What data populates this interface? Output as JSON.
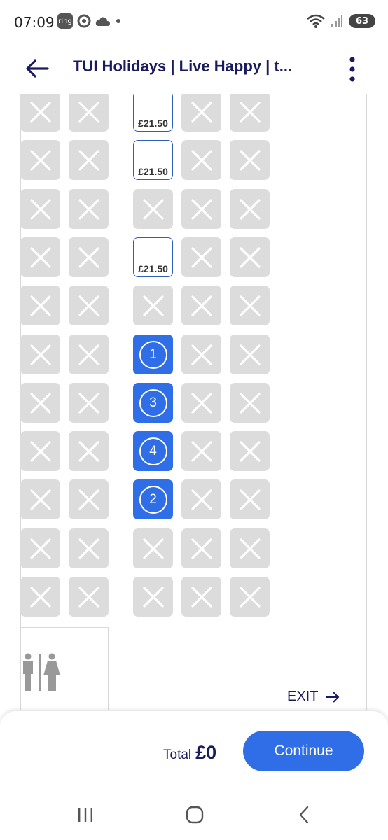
{
  "status_bar": {
    "time": "07:09",
    "ring_badge": "ring",
    "battery": "63",
    "wifi_label": "5",
    "signal_label": "R"
  },
  "header": {
    "title": "TUI Holidays | Live Happy | t..."
  },
  "seat_columns": [
    29,
    98,
    190,
    259,
    328
  ],
  "seat_rows": [
    [
      "x",
      "x",
      {
        "t": "a",
        "price": "£21.50"
      },
      "x",
      "x"
    ],
    [
      "x",
      "x",
      {
        "t": "a",
        "price": "£21.50"
      },
      "x",
      "x"
    ],
    [
      "x",
      "x",
      "x",
      "x",
      "x"
    ],
    [
      "x",
      "x",
      {
        "t": "a",
        "price": "£21.50"
      },
      "x",
      "x"
    ],
    [
      "x",
      "x",
      "x",
      "x",
      "x"
    ],
    [
      "x",
      "x",
      {
        "t": "s",
        "num": "1"
      },
      "x",
      "x"
    ],
    [
      "x",
      "x",
      {
        "t": "s",
        "num": "3"
      },
      "x",
      "x"
    ],
    [
      "x",
      "x",
      {
        "t": "s",
        "num": "4"
      },
      "x",
      "x"
    ],
    [
      "x",
      "x",
      {
        "t": "s",
        "num": "2"
      },
      "x",
      "x"
    ],
    [
      "x",
      "x",
      "x",
      "x",
      "x"
    ],
    [
      "x",
      "x",
      "x",
      "x",
      "x"
    ]
  ],
  "exit_label": "EXIT",
  "footer": {
    "total_label": "Total",
    "total_value": "£0",
    "continue_label": "Continue"
  },
  "colors": {
    "brand_blue": "#2f6ee6",
    "navy": "#1a1a5e",
    "unavailable": "#dcdcdc"
  }
}
